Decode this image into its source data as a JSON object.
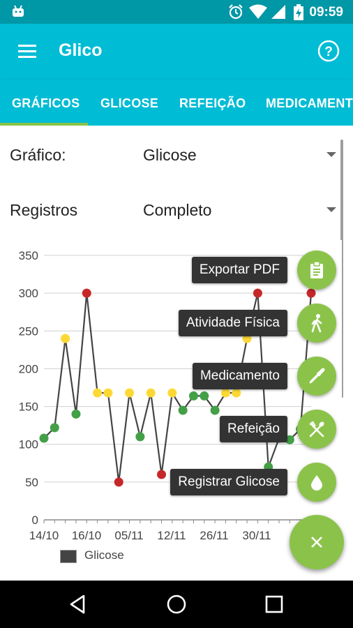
{
  "status_bar": {
    "time": "09:59",
    "icons": [
      "android-icon",
      "alarm-icon",
      "wifi-icon",
      "signal-icon",
      "battery-charging-icon"
    ]
  },
  "app_bar": {
    "title": "Glico",
    "menu_icon": "hamburger-menu-icon",
    "help_icon": "help-circle-icon"
  },
  "tabs": [
    {
      "label": "GRÁFICOS",
      "active": true
    },
    {
      "label": "GLICOSE",
      "active": false
    },
    {
      "label": "REFEIÇÃO",
      "active": false
    },
    {
      "label": "MEDICAMENT",
      "active": false
    }
  ],
  "filters": {
    "chart_label": "Gráfico:",
    "chart_value": "Glicose",
    "records_label": "Registros",
    "records_value": "Completo"
  },
  "fab_menu": [
    {
      "label": "Exportar PDF",
      "icon": "clipboard-icon"
    },
    {
      "label": "Atividade Física",
      "icon": "walking-icon"
    },
    {
      "label": "Medicamento",
      "icon": "eyedropper-icon"
    },
    {
      "label": "Refeição",
      "icon": "fork-spoon-icon"
    },
    {
      "label": "Registrar Glicose",
      "icon": "drop-icon"
    }
  ],
  "fab_main_icon": "close-icon",
  "colors": {
    "accent": "#8bc34a",
    "primary": "#00bcd4",
    "primary_dark": "#0097a7",
    "high": "#c62828",
    "medium": "#fdd835",
    "normal": "#43a047",
    "low": "#e53935"
  },
  "chart_data": {
    "type": "line",
    "ylim": [
      0,
      350
    ],
    "y_ticks": [
      "0",
      "50",
      "100",
      "150",
      "200",
      "250",
      "300",
      "350"
    ],
    "x_ticks": [
      "14/10",
      "16/10",
      "05/11",
      "12/11",
      "26/11",
      "30/11"
    ],
    "grid": true,
    "legend": "bottom-left",
    "series": [
      {
        "name": "Glicose",
        "values": [
          108,
          122,
          240,
          140,
          300,
          168,
          168,
          50,
          168,
          110,
          168,
          60,
          168,
          145,
          164,
          164,
          145,
          168,
          168,
          240,
          300,
          70,
          108,
          106,
          120,
          300
        ],
        "point_colors": [
          "green",
          "green",
          "yellow",
          "green",
          "red",
          "yellow",
          "yellow",
          "red",
          "yellow",
          "green",
          "yellow",
          "red",
          "yellow",
          "green",
          "green",
          "green",
          "green",
          "yellow",
          "yellow",
          "yellow",
          "red",
          "green",
          "green",
          "green",
          "green",
          "red"
        ]
      }
    ]
  }
}
